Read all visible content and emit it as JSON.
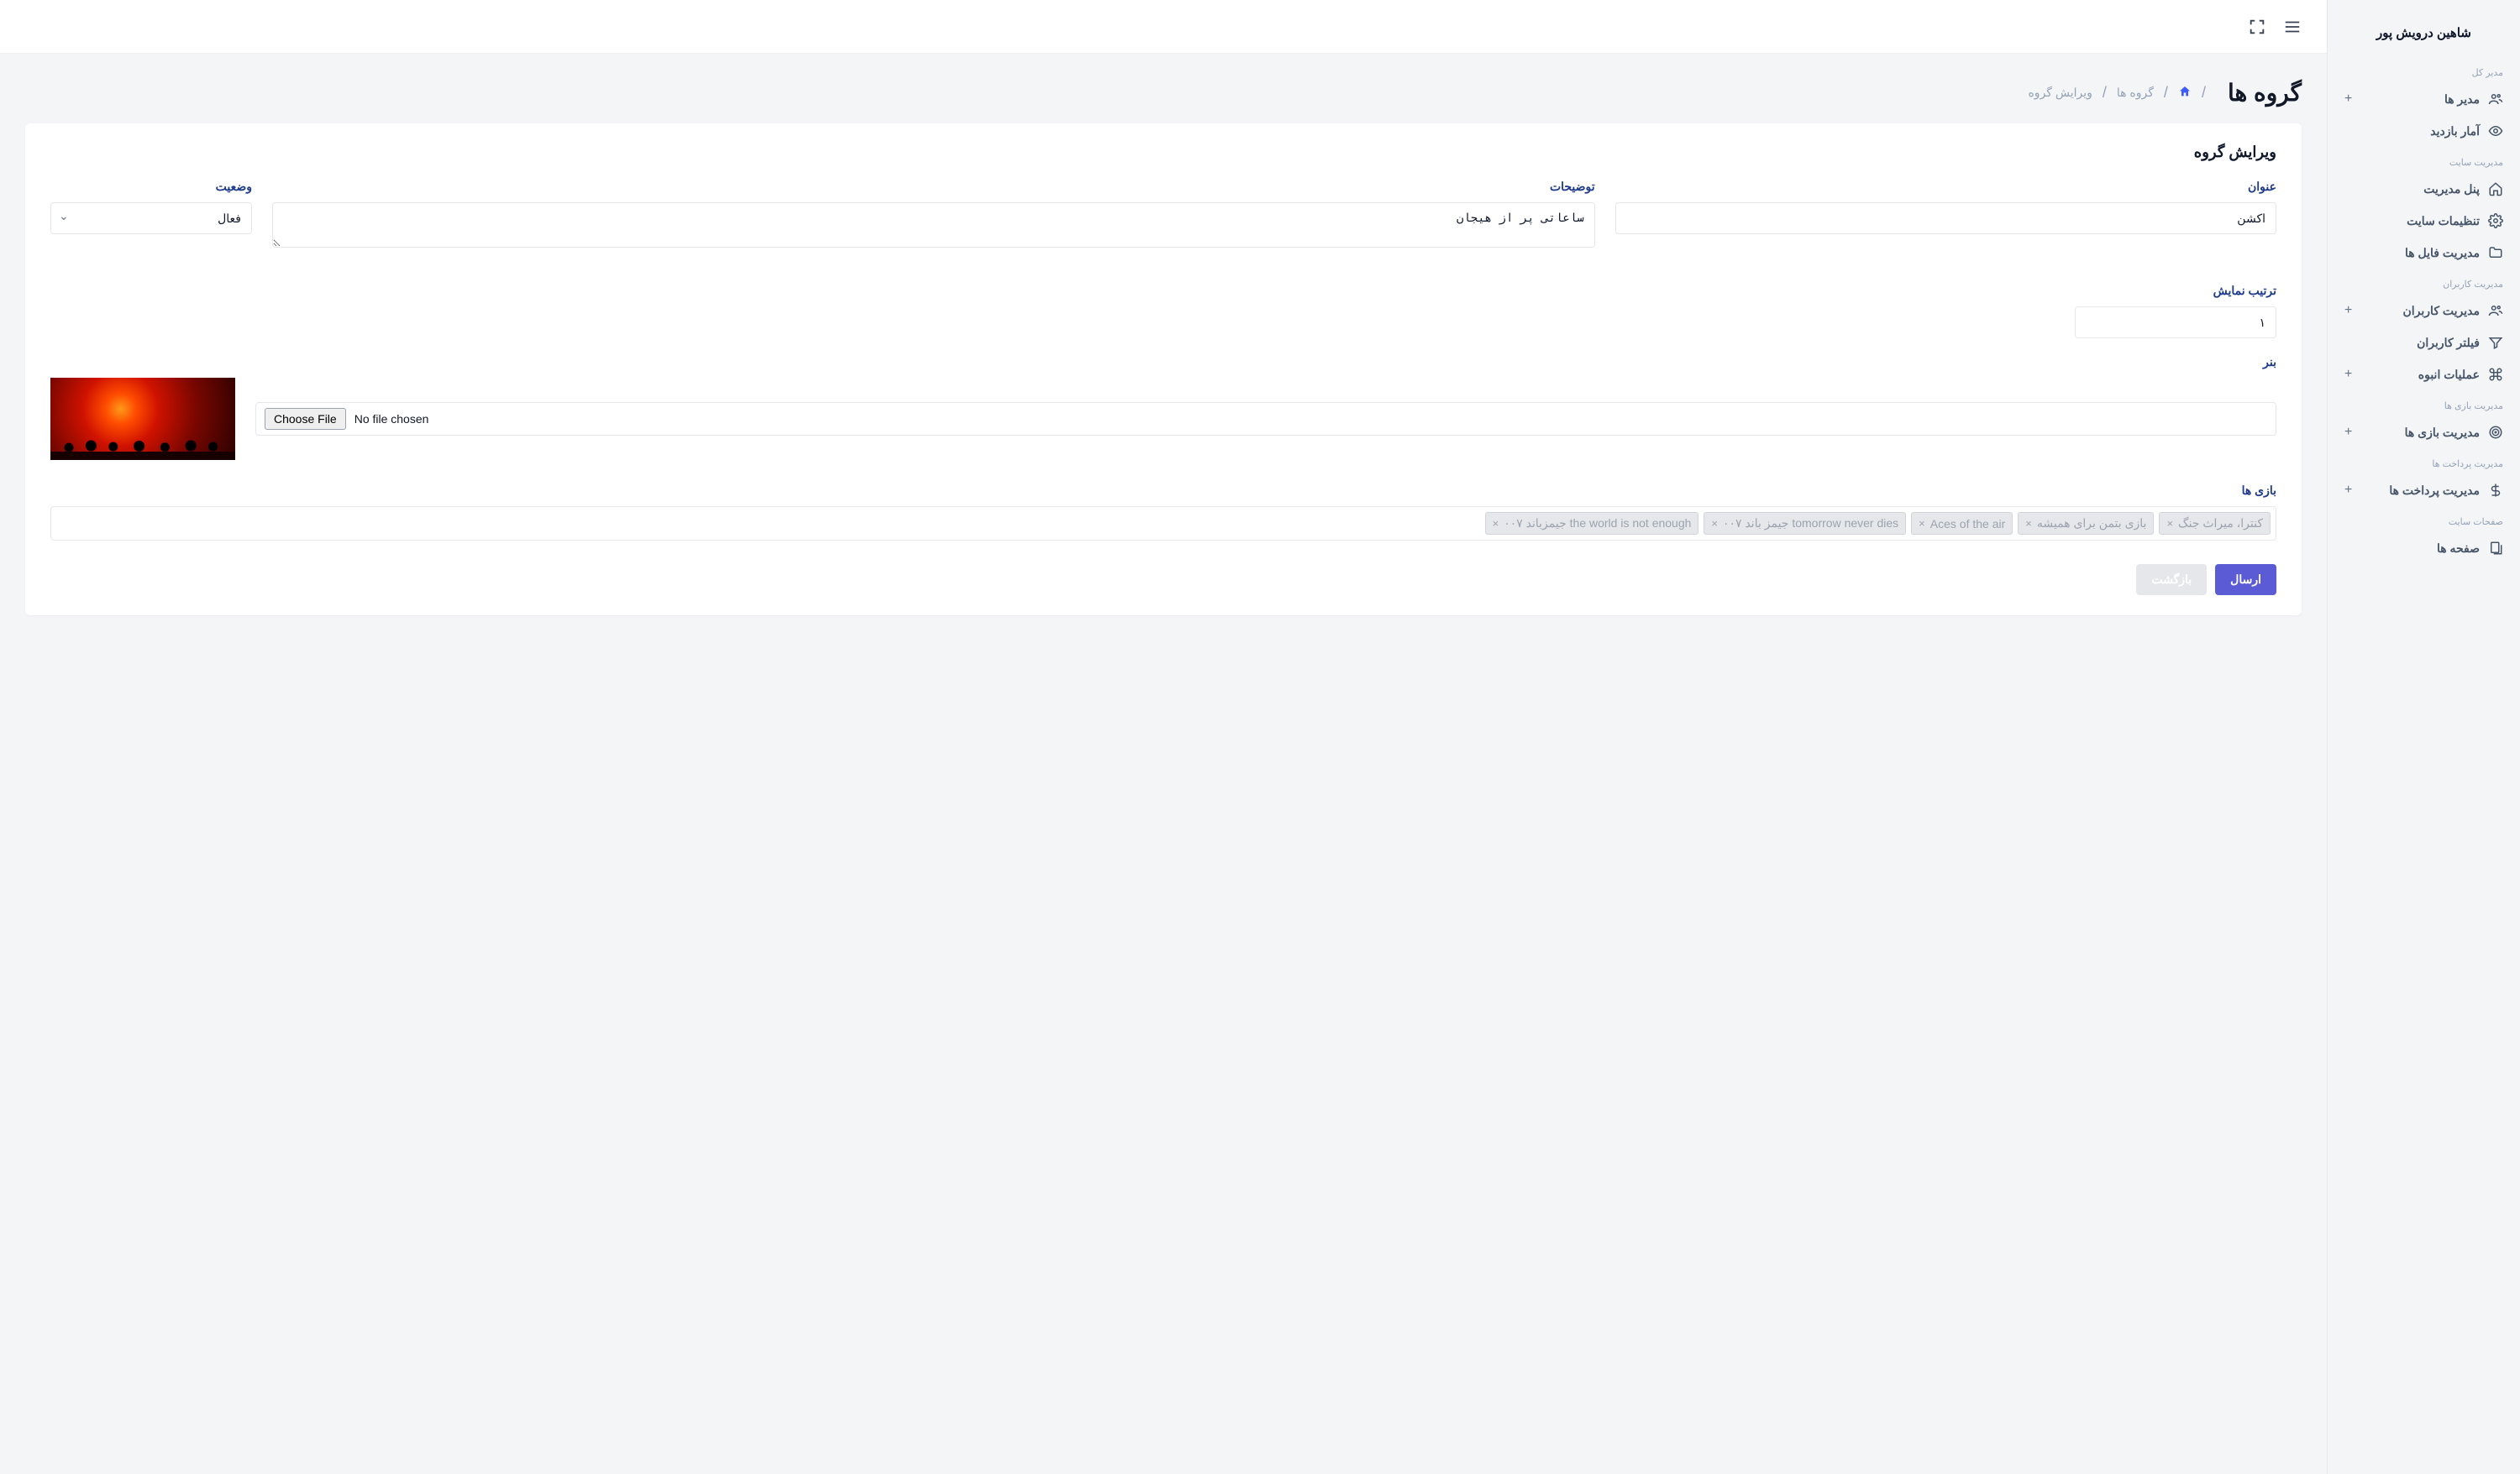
{
  "profile": {
    "name": "شاهین درویش پور"
  },
  "sidebar": {
    "sections": [
      {
        "title": "مدیر کل",
        "items": [
          {
            "label": "مدیر ها",
            "icon": "users-icon",
            "plus": true
          },
          {
            "label": "آمار بازدید",
            "icon": "eye-icon",
            "plus": false
          }
        ]
      },
      {
        "title": "مدیریت سایت",
        "items": [
          {
            "label": "پنل مدیریت",
            "icon": "home-icon",
            "plus": false
          },
          {
            "label": "تنظیمات سایت",
            "icon": "gear-icon",
            "plus": false
          },
          {
            "label": "مدیریت فایل ها",
            "icon": "folder-icon",
            "plus": false
          }
        ]
      },
      {
        "title": "مدیریت کاربران",
        "items": [
          {
            "label": "مدیریت کاربران",
            "icon": "users-icon",
            "plus": true
          },
          {
            "label": "فیلتر کاربران",
            "icon": "filter-icon",
            "plus": false
          },
          {
            "label": "عملیات انبوه",
            "icon": "command-icon",
            "plus": true
          }
        ]
      },
      {
        "title": "مدیریت بازی ها",
        "items": [
          {
            "label": "مدیریت بازی ها",
            "icon": "target-icon",
            "plus": true
          }
        ]
      },
      {
        "title": "مدیریت پرداخت ها",
        "items": [
          {
            "label": "مدیریت پرداخت ها",
            "icon": "dollar-icon",
            "plus": true
          }
        ]
      },
      {
        "title": "صفحات سایت",
        "items": [
          {
            "label": "صفحه ها",
            "icon": "pages-icon",
            "plus": false
          }
        ]
      }
    ]
  },
  "page": {
    "title": "گروه ها",
    "breadcrumb": {
      "groups": "گروه ها",
      "current": "ویرایش گروه"
    }
  },
  "card": {
    "title": "ویرایش گروه"
  },
  "form": {
    "title_label": "عنوان",
    "title_value": "اکشن",
    "desc_label": "توضیحات",
    "desc_value": "ساعاتی پر از هیجان",
    "status_label": "وضعیت",
    "status_value": "فعال",
    "order_label": "ترتیب نمایش",
    "order_value": "۱",
    "banner_label": "بنر",
    "file_button": "Choose File",
    "file_text": "No file chosen",
    "games_label": "بازی ها",
    "tags": [
      "کنترا، میراث جنگ",
      "بازی بتمن برای همیشه",
      "Aces of the air",
      "tomorrow never dies جیمز باند ۰۰۷",
      "the world is not enough جیمزباند ۰۰۷"
    ]
  },
  "actions": {
    "submit": "ارسال",
    "back": "بازگشت"
  }
}
